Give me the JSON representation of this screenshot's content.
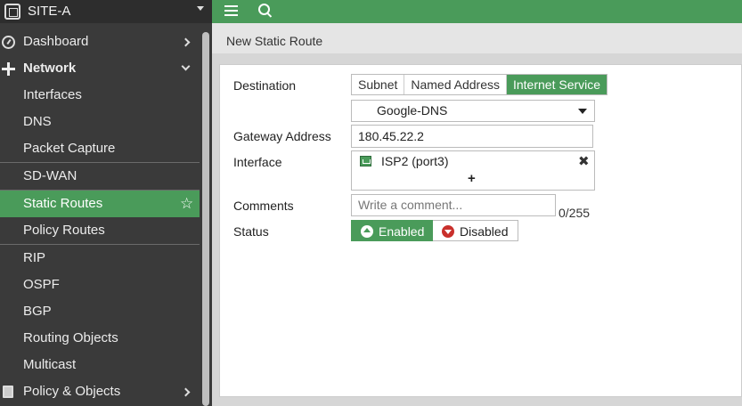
{
  "sidebar": {
    "site_name": "SITE-A",
    "items": [
      {
        "label": "Dashboard",
        "icon": "dashboard-gauge-icon"
      },
      {
        "label": "Network",
        "icon": "network-arrows-icon"
      },
      {
        "label": "Interfaces"
      },
      {
        "label": "DNS"
      },
      {
        "label": "Packet Capture"
      },
      {
        "label": "SD-WAN"
      },
      {
        "label": "Static Routes",
        "active": true
      },
      {
        "label": "Policy Routes"
      },
      {
        "label": "RIP"
      },
      {
        "label": "OSPF"
      },
      {
        "label": "BGP"
      },
      {
        "label": "Routing Objects"
      },
      {
        "label": "Multicast"
      },
      {
        "label": "Policy & Objects",
        "icon": "policy-document-icon"
      }
    ]
  },
  "topbar": {
    "menu_icon": "hamburger-menu-icon",
    "search_icon": "search-icon"
  },
  "page": {
    "title": "New Static Route"
  },
  "form": {
    "destination": {
      "label": "Destination",
      "options": [
        "Subnet",
        "Named Address",
        "Internet Service"
      ],
      "selected": "Internet Service",
      "service_value": "Google-DNS"
    },
    "gateway": {
      "label": "Gateway Address",
      "value": "180.45.22.2"
    },
    "interface": {
      "label": "Interface",
      "value": "ISP2 (port3)",
      "add_symbol": "+",
      "remove_symbol": "✖"
    },
    "comments": {
      "label": "Comments",
      "placeholder": "Write a comment...",
      "counter": "0/255"
    },
    "status": {
      "label": "Status",
      "enabled_label": "Enabled",
      "disabled_label": "Disabled",
      "selected": "Enabled"
    }
  },
  "colors": {
    "accent": "#4a9b5a",
    "sidebar_bg": "#3a3a3a",
    "disabled_red": "#c9302c"
  }
}
